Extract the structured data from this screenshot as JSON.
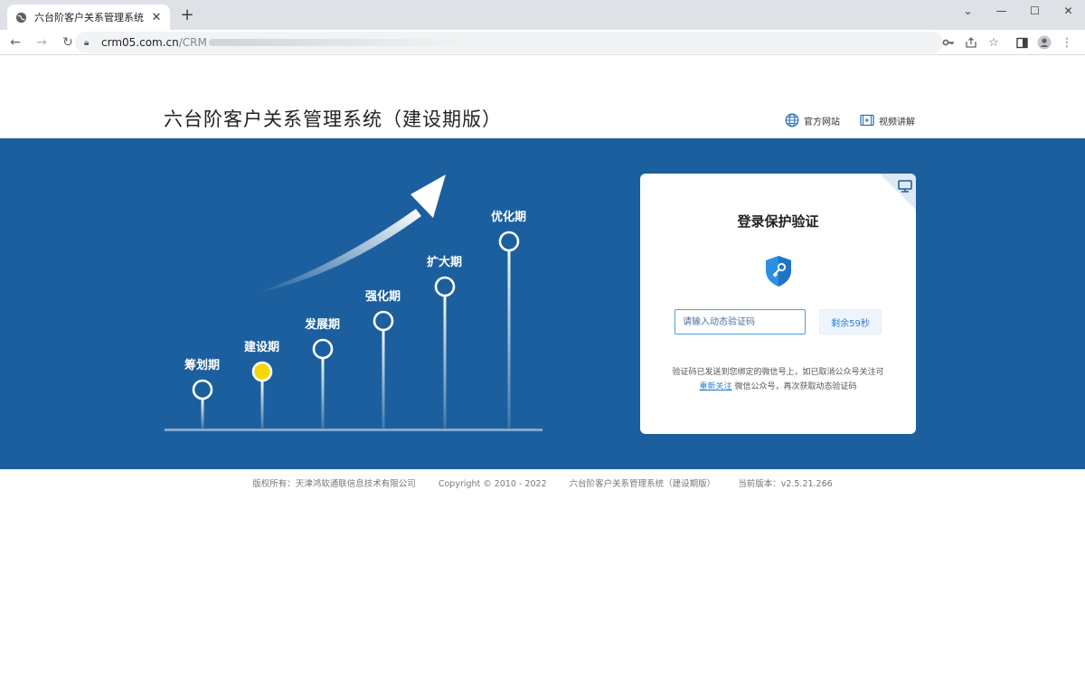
{
  "browser": {
    "tab_title": "六台阶客户关系管理系统（建设期版）",
    "url_host": "crm05.com.cn",
    "url_path": "/CRM"
  },
  "header": {
    "title": "六台阶客户关系管理系统（建设期版）",
    "links": [
      {
        "label": "官方网站",
        "icon": "globe-icon"
      },
      {
        "label": "视频讲解",
        "icon": "video-icon"
      }
    ]
  },
  "stages": [
    {
      "label": "筹划期",
      "active": false
    },
    {
      "label": "建设期",
      "active": true
    },
    {
      "label": "发展期",
      "active": false
    },
    {
      "label": "强化期",
      "active": false
    },
    {
      "label": "扩大期",
      "active": false
    },
    {
      "label": "优化期",
      "active": false
    }
  ],
  "login_card": {
    "title": "登录保护验证",
    "input_placeholder": "请输入动态验证码",
    "timer_label": "剩余59秒",
    "hint_before": "验证码已发送到您绑定的微信号上，如已取消公众号关注可",
    "hint_link": "重新关注",
    "hint_after": "微信公众号，再次获取动态验证码"
  },
  "footer": {
    "copyright_owner": "版权所有：天津鸿软通联信息技术有限公司",
    "copyright": "Copyright © 2010 - 2022",
    "product": "六台阶客户关系管理系统（建设期版）",
    "version": "当前版本：v2.5.21.266"
  },
  "colors": {
    "banner": "#1b5f9e",
    "active_stage": "#f5d800",
    "accent": "#2d7fd0"
  }
}
